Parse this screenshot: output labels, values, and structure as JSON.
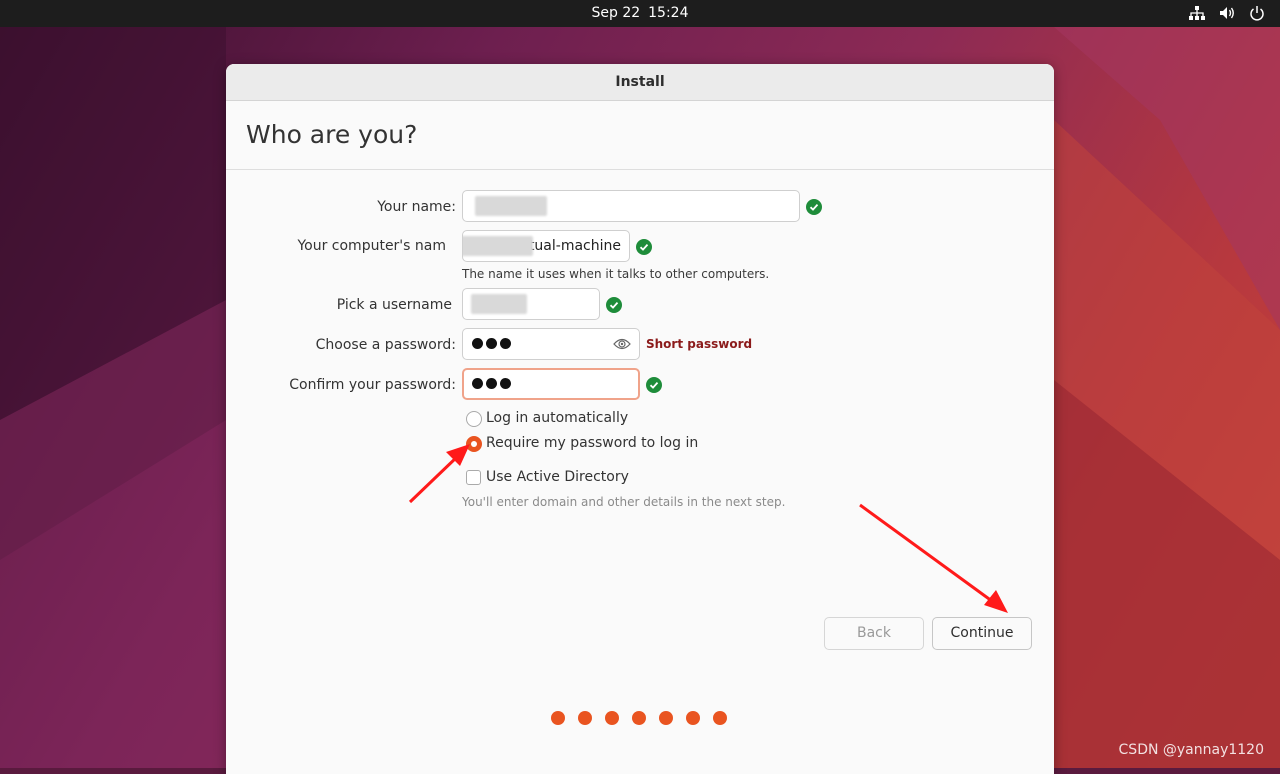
{
  "topbar": {
    "date": "Sep 22",
    "time": "15:24",
    "tray_icons": [
      "network-icon",
      "volume-icon",
      "power-icon"
    ]
  },
  "window": {
    "title": "Install",
    "heading": "Who are you?"
  },
  "form": {
    "name_label": "Your name:",
    "name_value": "",
    "computer_label": "Your computer's nam",
    "computer_value": "irtual-machine",
    "computer_hint": "The name it uses when it talks to other computers.",
    "username_label": "Pick a username",
    "username_value": "",
    "password_label": "Choose a password:",
    "password_strength": "Short password",
    "confirm_label": "Confirm your password:",
    "login_auto_label": "Log in automatically",
    "require_password_label": "Require my password to log in",
    "require_password_selected": true,
    "active_directory_label": "Use Active Directory",
    "active_directory_checked": false,
    "active_directory_hint": "You'll enter domain and other details in the next step."
  },
  "buttons": {
    "back": "Back",
    "continue": "Continue"
  },
  "progress": {
    "step_count": 7,
    "accent": "#e95420"
  },
  "colors": {
    "accent": "#e95420",
    "ok": "#1e8c3a",
    "warning": "#8b1a1a",
    "annotation_arrow": "#ff1a1a"
  },
  "watermark": "CSDN @yannay1120"
}
